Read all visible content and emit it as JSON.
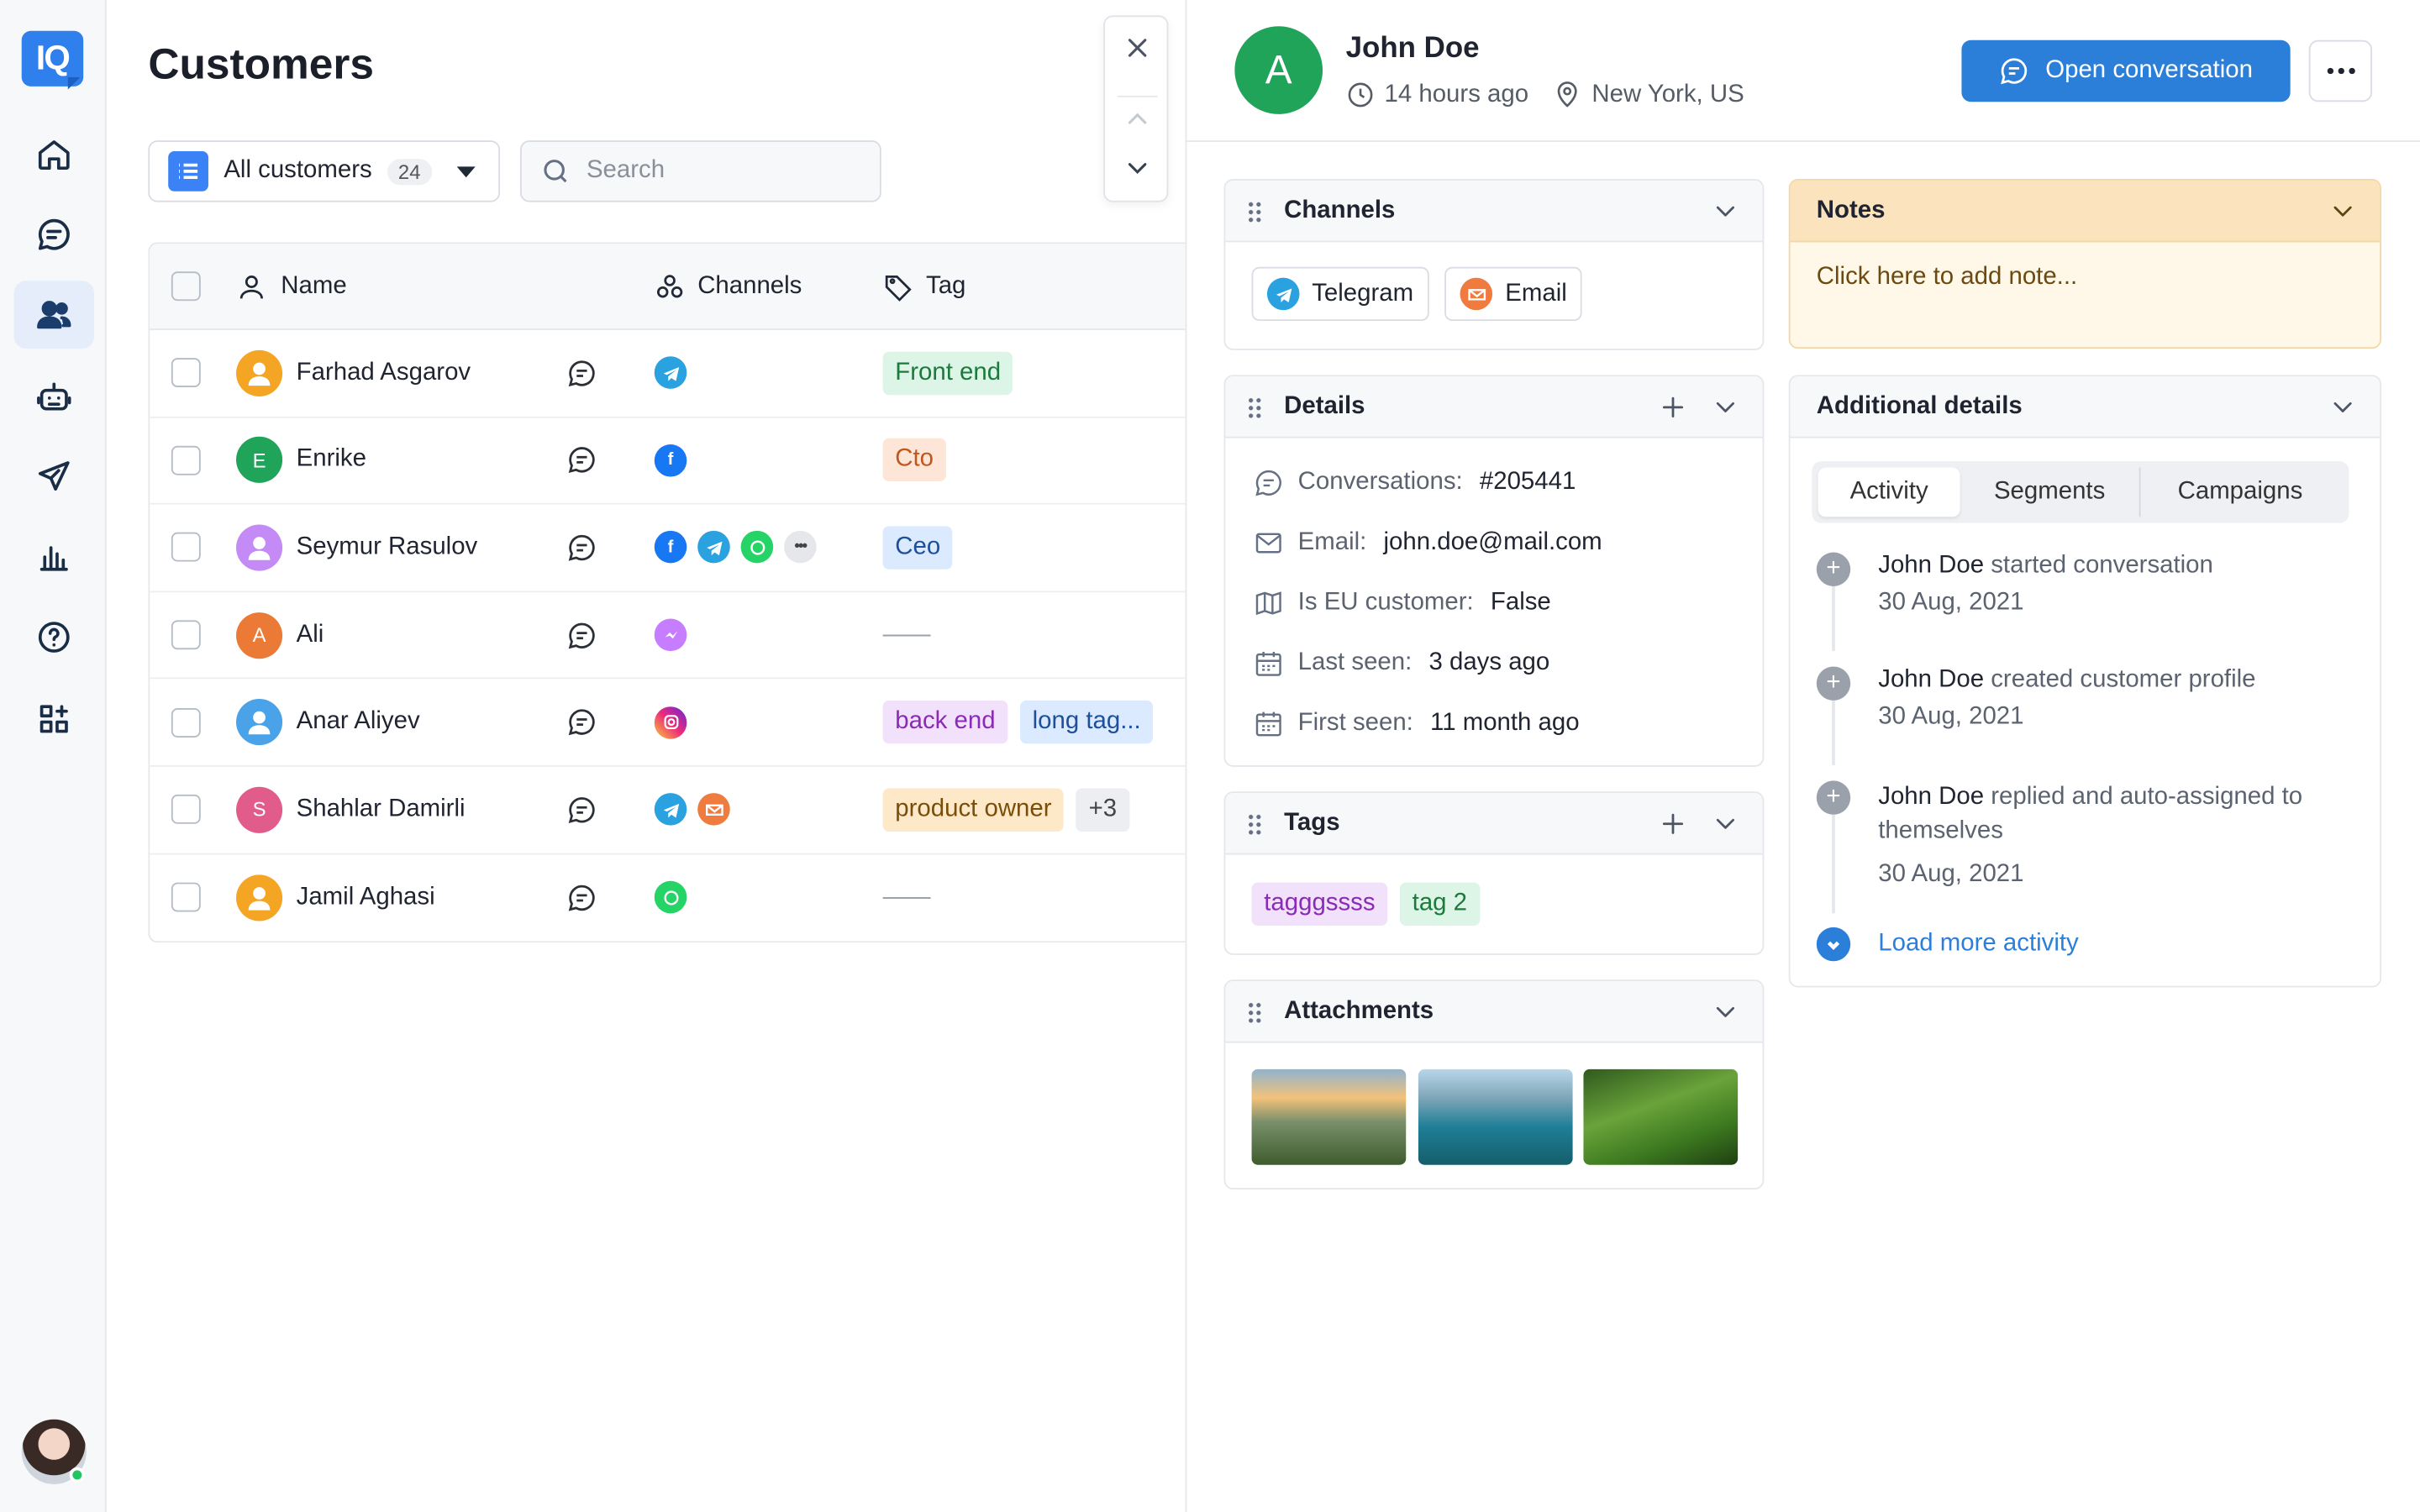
{
  "rail": {
    "logo": "IQ",
    "items": [
      {
        "icon": "home-icon"
      },
      {
        "icon": "chat-icon"
      },
      {
        "icon": "users-icon",
        "active": true
      },
      {
        "icon": "bot-icon"
      },
      {
        "icon": "send-icon"
      },
      {
        "icon": "chart-icon"
      },
      {
        "icon": "help-icon"
      },
      {
        "icon": "apps-icon"
      }
    ]
  },
  "page": {
    "title": "Customers",
    "filter_label": "All customers",
    "filter_count": "24",
    "search_placeholder": "Search"
  },
  "table": {
    "headers": {
      "name": "Name",
      "channels": "Channels",
      "tag": "Tag"
    },
    "rows": [
      {
        "name": "Farhad Asgarov",
        "avatar": "person",
        "channels": [
          "telegram"
        ],
        "tags": [
          {
            "label": "Front end",
            "color": "green"
          }
        ]
      },
      {
        "name": "Enrike",
        "avatar": "E",
        "avatar_color": "#1fa45a",
        "channels": [
          "facebook"
        ],
        "tags": [
          {
            "label": "Cto",
            "color": "orange"
          }
        ]
      },
      {
        "name": "Seymur Rasulov",
        "avatar": "person-violet",
        "channels": [
          "facebook",
          "telegram",
          "whatsapp",
          "more"
        ],
        "tags": [
          {
            "label": "Ceo",
            "color": "blue"
          }
        ]
      },
      {
        "name": "Ali",
        "avatar": "A",
        "avatar_color": "#ea7a35",
        "channels": [
          "messenger"
        ],
        "tags": [],
        "empty": "——"
      },
      {
        "name": "Anar Aliyev",
        "avatar": "person-blue",
        "channels": [
          "instagram"
        ],
        "tags": [
          {
            "label": "back end",
            "color": "purple"
          },
          {
            "label": "long tag...",
            "color": "sky"
          }
        ]
      },
      {
        "name": "Shahlar Damirli",
        "avatar": "S",
        "avatar_color": "#e25c8b",
        "channels": [
          "telegram",
          "email"
        ],
        "tags": [
          {
            "label": "product owner",
            "color": "yellow"
          },
          {
            "label": "+3",
            "color": "grey"
          }
        ]
      },
      {
        "name": "Jamil Aghasi",
        "avatar": "person",
        "channels": [
          "whatsapp"
        ],
        "tags": [],
        "empty": "——"
      }
    ]
  },
  "customer": {
    "initial": "A",
    "name": "John Doe",
    "last_active": "14 hours ago",
    "location": "New York, US",
    "open_conversation": "Open conversation"
  },
  "channels_card": {
    "title": "Channels",
    "items": [
      {
        "label": "Telegram",
        "icon": "telegram-icon"
      },
      {
        "label": "Email",
        "icon": "email-icon"
      }
    ]
  },
  "details_card": {
    "title": "Details",
    "rows": [
      {
        "icon": "chat-icon",
        "key": "Conversations:",
        "value": "#205441"
      },
      {
        "icon": "mail-icon",
        "key": "Email:",
        "value": "john.doe@mail.com"
      },
      {
        "icon": "map-icon",
        "key": "Is EU customer:",
        "value": "False"
      },
      {
        "icon": "calendar-icon",
        "key": "Last seen:",
        "value": "3 days ago"
      },
      {
        "icon": "calendar-icon",
        "key": "First seen:",
        "value": "11 month ago"
      }
    ]
  },
  "tags_card": {
    "title": "Tags",
    "tags": [
      {
        "label": "tagggssss",
        "color": "purple"
      },
      {
        "label": "tag 2",
        "color": "green"
      }
    ]
  },
  "attachments_card": {
    "title": "Attachments",
    "images": [
      "mountain-sunrise",
      "lake-island",
      "green-hills"
    ]
  },
  "notes_card": {
    "title": "Notes",
    "placeholder": "Click here to add note..."
  },
  "additional_card": {
    "title": "Additional details",
    "tabs": [
      "Activity",
      "Segments",
      "Campaigns"
    ],
    "active_tab": "Activity",
    "activity": [
      {
        "actor": "John Doe",
        "text": " started conversation",
        "date": "30 Aug, 2021"
      },
      {
        "actor": "John Doe",
        "text": " created customer profile",
        "date": "30 Aug, 2021"
      },
      {
        "actor": "John Doe",
        "text": " replied and auto-assigned to themselves",
        "date": "30 Aug, 2021"
      }
    ],
    "load_more": "Load more activity"
  },
  "colors": {
    "accent": "#2b7fd9",
    "active_nav": "#e4edf9",
    "customer_avatar": "#1fa45a",
    "notes_bg": "#fff7e7"
  }
}
